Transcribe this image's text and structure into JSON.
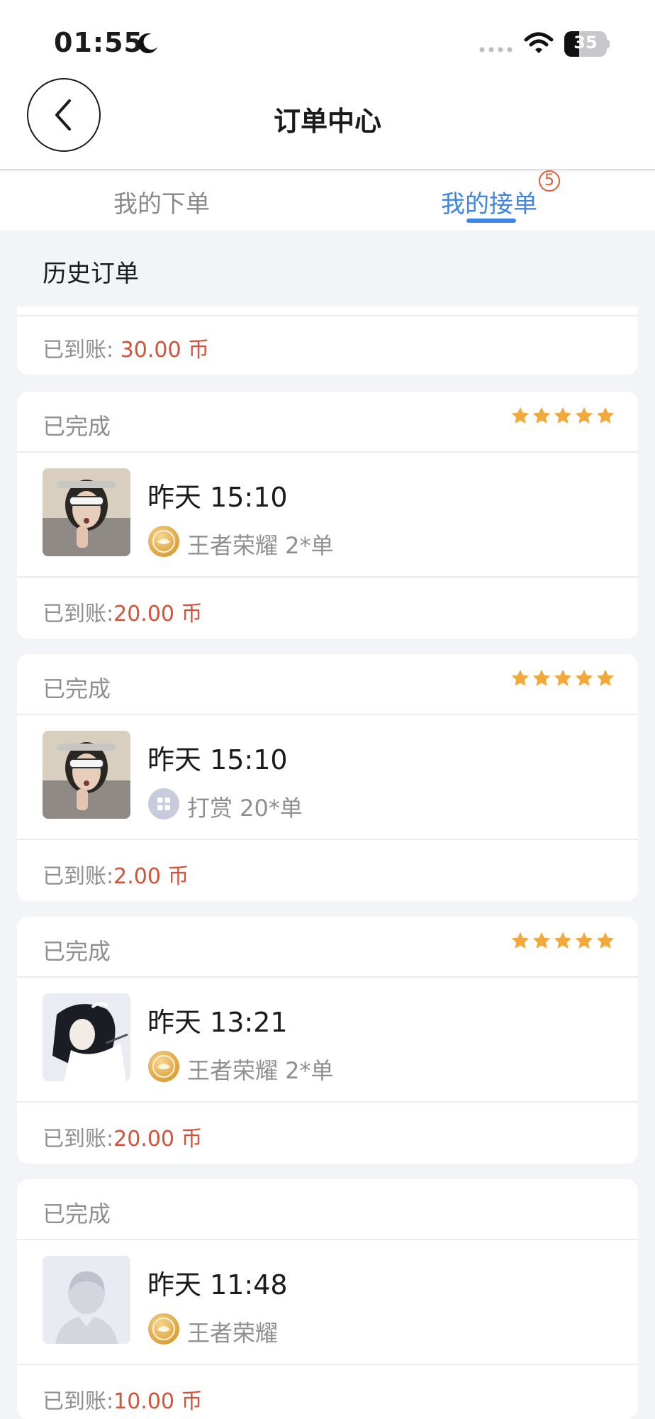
{
  "status_bar": {
    "time": "01:55",
    "battery": "35",
    "battery_level": 0.35
  },
  "header": {
    "title": "订单中心"
  },
  "tabs": [
    {
      "label": "我的下单",
      "active": false
    },
    {
      "label": "我的接单",
      "active": true,
      "badge": "5"
    }
  ],
  "section_title": "历史订单",
  "partial_card": {
    "amount_label": "已到账:",
    "amount": "30.00 币"
  },
  "orders": [
    {
      "status": "已完成",
      "rating": 5,
      "time": "昨天 15:10",
      "game": "王者荣耀 2*单",
      "amount_label": "已到账:",
      "amount": "20.00 币",
      "avatar": "girl-photo",
      "game_icon": "honor-of-kings-icon"
    },
    {
      "status": "已完成",
      "rating": 5,
      "time": "昨天 15:10",
      "game": "打赏 20*单",
      "amount_label": "已到账:",
      "amount": "2.00 币",
      "avatar": "girl-photo",
      "game_icon": "tip-grid-icon"
    },
    {
      "status": "已完成",
      "rating": 5,
      "time": "昨天 13:21",
      "game": "王者荣耀 2*单",
      "amount_label": "已到账:",
      "amount": "20.00 币",
      "avatar": "anime-photo",
      "game_icon": "honor-of-kings-icon"
    },
    {
      "status": "已完成",
      "rating": 0,
      "time": "昨天 11:48",
      "game": "王者荣耀",
      "amount_label": "已到账:",
      "amount": "10.00 币",
      "avatar": "default-avatar",
      "game_icon": "honor-of-kings-icon"
    }
  ],
  "colors": {
    "accent": "#3d86e8",
    "amount": "#d2533a",
    "star": "#f2a93b",
    "badge": "#e05a3c"
  }
}
